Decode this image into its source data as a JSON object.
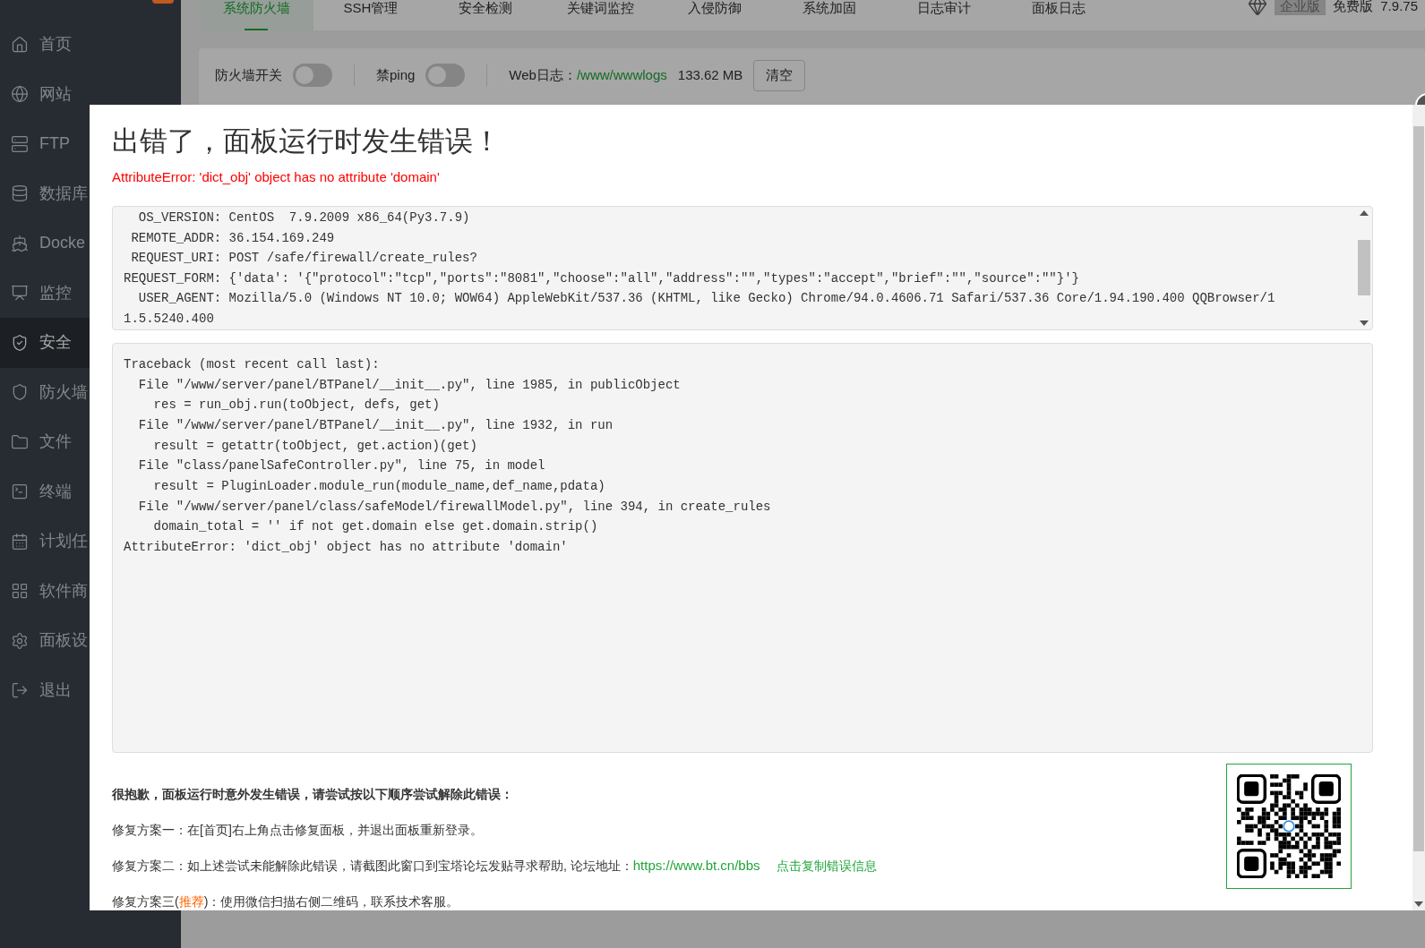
{
  "sidebar": {
    "items": [
      {
        "label": "首页",
        "selected": false
      },
      {
        "label": "网站",
        "selected": false
      },
      {
        "label": "FTP",
        "selected": false
      },
      {
        "label": "数据库",
        "selected": false
      },
      {
        "label": "Docke",
        "selected": false
      },
      {
        "label": "监控",
        "selected": false
      },
      {
        "label": "安全",
        "selected": true
      },
      {
        "label": "防火墙",
        "selected": false
      },
      {
        "label": "文件",
        "selected": false
      },
      {
        "label": "终端",
        "selected": false
      },
      {
        "label": "计划任",
        "selected": false
      },
      {
        "label": "软件商",
        "selected": false
      },
      {
        "label": "面板设",
        "selected": false
      },
      {
        "label": "退出",
        "selected": false
      }
    ]
  },
  "tabs": [
    {
      "label": "系统防火墙",
      "selected": true
    },
    {
      "label": "SSH管理",
      "selected": false
    },
    {
      "label": "安全检测",
      "selected": false
    },
    {
      "label": "关键词监控",
      "selected": false
    },
    {
      "label": "入侵防御",
      "selected": false
    },
    {
      "label": "系统加固",
      "selected": false
    },
    {
      "label": "日志审计",
      "selected": false
    },
    {
      "label": "面板日志",
      "selected": false
    }
  ],
  "edition": {
    "enterprise": "企业版",
    "free": "免费版",
    "version": "7.9.75"
  },
  "firewall_bar": {
    "toggles": [
      {
        "label": "防火墙开关",
        "on": false
      },
      {
        "label": "禁ping",
        "on": false
      }
    ],
    "log_label": "Web日志：",
    "log_path": "/www/wwwlogs",
    "log_size": "133.62 MB",
    "clear_button": "清空"
  },
  "error_dialog": {
    "title": "出错了，面板运行时发生错误！",
    "error": "AttributeError: 'dict_obj' object has no attribute 'domain'",
    "request_info": [
      "  OS_VERSION: CentOS  7.9.2009 x86_64(Py3.7.9)",
      " REMOTE_ADDR: 36.154.169.249",
      " REQUEST_URI: POST /safe/firewall/create_rules?",
      "REQUEST_FORM: {'data': '{\"protocol\":\"tcp\",\"ports\":\"8081\",\"choose\":\"all\",\"address\":\"\",\"types\":\"accept\",\"brief\":\"\",\"source\":\"\"}'}",
      "  USER_AGENT: Mozilla/5.0 (Windows NT 10.0; WOW64) AppleWebKit/537.36 (KHTML, like Gecko) Chrome/94.0.4606.71 Safari/537.36 Core/1.94.190.400 QQBrowser/1",
      "1.5.5240.400"
    ],
    "traceback": [
      "Traceback (most recent call last):",
      "  File \"/www/server/panel/BTPanel/__init__.py\", line 1985, in publicObject",
      "    res = run_obj.run(toObject, defs, get)",
      "  File \"/www/server/panel/BTPanel/__init__.py\", line 1932, in run",
      "    result = getattr(toObject, get.action)(get)",
      "  File \"class/panelSafeController.py\", line 75, in model",
      "    result = PluginLoader.module_run(module_name,def_name,pdata)",
      "  File \"/www/server/panel/class/safeModel/firewallModel.py\", line 394, in create_rules",
      "    domain_total = '' if not get.domain else get.domain.strip()",
      "AttributeError: 'dict_obj' object has no attribute 'domain'"
    ],
    "help": {
      "heading": "很抱歉，面板运行时意外发生错误，请尝试按以下顺序尝试解除此错误：",
      "items": [
        {
          "kind": "plain",
          "text": "修复方案一：在[首页]右上角点击修复面板，并退出面板重新登录。"
        },
        {
          "kind": "links",
          "text": "修复方案二：如上述尝试未能解除此错误，请截图此窗口到宝塔论坛发贴寻求帮助, 论坛地址：",
          "link": "https://www.bt.cn/bbs",
          "action": "点击复制错误信息"
        },
        {
          "kind": "highlight",
          "before": "修复方案三(",
          "highlight": "推荐",
          "after": ")：使用微信扫描右侧二维码，联系技术客服。"
        }
      ]
    }
  }
}
